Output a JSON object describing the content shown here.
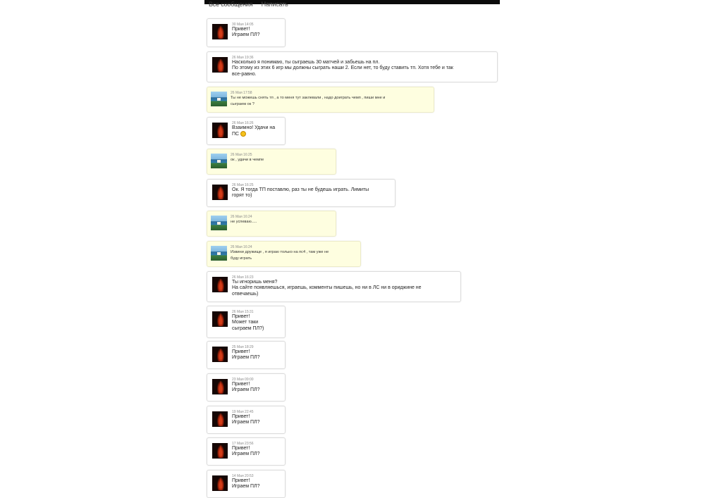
{
  "tabs": [
    {
      "label": "Все сообщения"
    },
    {
      "label": "Написать"
    }
  ],
  "messages": [
    {
      "sender": "me",
      "date": "30 Мая 14:05",
      "lines": [
        "Привет!",
        "Играем ПЛ?"
      ]
    },
    {
      "sender": "me",
      "date": "26 Мая 19:36",
      "lines": [
        "Насколько я понимаю, ты сыграешь 30 матчей и забьешь на пл.",
        "По этому из этих 6 игр мы должны сыграть наши 2. Если нет, то буду ставить тп. Хотя тебе и так",
        "все-равно."
      ]
    },
    {
      "sender": "other",
      "date": "26 Мая 17:58",
      "lines": [
        "Ты не можешь снять тп , а то меня тут заклевали , надо доиграть чемп , пиши мне и",
        "сыграем ок ?"
      ]
    },
    {
      "sender": "me",
      "date": "26 Мая 16:26",
      "lines": [
        "Взаимно! Удачи на",
        "ПС"
      ],
      "emoji": "smiley-icon"
    },
    {
      "sender": "other",
      "date": "26 Мая 16:25",
      "lines": [
        "ок , удачи в чемпе"
      ]
    },
    {
      "sender": "me",
      "date": "26 Мая 16:25",
      "lines": [
        "Ок. Я тогда ТП поставлю, раз ты не будешь играть. Лимиты",
        "горят то)"
      ]
    },
    {
      "sender": "other",
      "date": "26 Мая 16:24",
      "lines": [
        "не успеваю....."
      ]
    },
    {
      "sender": "other",
      "date": "26 Мая 16:24",
      "lines": [
        "Извини дружище , я играю только на пс4 , там уже не",
        "буду играть"
      ]
    },
    {
      "sender": "me",
      "date": "26 Мая 16:23",
      "lines": [
        "Ты игноришь меня?",
        "На сайте появляешься, играешь, комменты пишешь, но ни в ЛС ни в ориджине не",
        "отвечаешь)"
      ]
    },
    {
      "sender": "me",
      "date": "26 Мая 15:31",
      "lines": [
        "Привет!",
        "Может таки",
        "сыграем ПЛ?)"
      ]
    },
    {
      "sender": "me",
      "date": "25 Мая 18:29",
      "lines": [
        "Привет!",
        "Играем ПЛ?"
      ]
    },
    {
      "sender": "me",
      "date": "23 Мая 09:00",
      "lines": [
        "Привет!",
        "Играем ПЛ?"
      ]
    },
    {
      "sender": "me",
      "date": "19 Мая 22:45",
      "lines": [
        "Привет!",
        "Играем ПЛ?"
      ]
    },
    {
      "sender": "me",
      "date": "17 Мая 23:56",
      "lines": [
        "Привет!",
        "Играем ПЛ?"
      ]
    },
    {
      "sender": "me",
      "date": "14 Мая 20:53",
      "lines": [
        "Привет!",
        "Играем ПЛ?"
      ]
    }
  ]
}
